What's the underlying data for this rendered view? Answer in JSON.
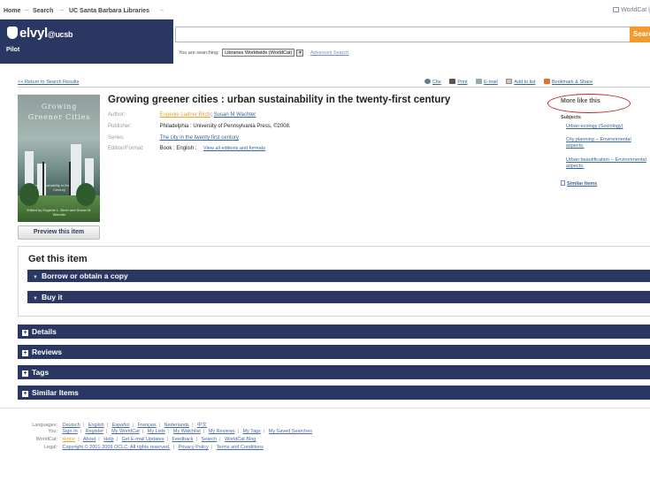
{
  "topnav": {
    "items": [
      "Home",
      "Search",
      "UC Santa Barbara Libraries"
    ],
    "worldcat_label": "WorldCat |"
  },
  "header": {
    "logo_text": "elvyl",
    "logo_suffix": "@ucsb",
    "pilot_label": "Pilot",
    "search_value": "",
    "search_button": "Search",
    "searching_label": "You are searching:",
    "scope_value": "Libraries Worldwide (WorldCat)",
    "advanced_search": "Advanced Search"
  },
  "result": {
    "back_link": "<< Return to Search Results",
    "actions": [
      "Cite",
      "Print",
      "E-mail",
      "Add to list",
      "Bookmark & Share"
    ],
    "title": "Growing greener cities : urban sustainability in the twenty-first century",
    "cover_title": "Growing Greener Cities",
    "cover_subtitle": "Urban Sustainability in the Twenty-First Century",
    "cover_authors": "Edited by Eugenie L. Birch and Susan M. Wachter",
    "preview_button": "Preview this item",
    "fields": {
      "author_label": "Author:",
      "author_1": "Eugenie Ladner Birch",
      "author_sep": ";",
      "author_2": "Susan M Wachter",
      "publisher_label": "Publisher:",
      "publisher": "Philadelphia : University of Pennsylvania Press, ©2008.",
      "series_label": "Series:",
      "series": "The city in the twenty-first century",
      "edition_label": "Edition/Format:",
      "edition": "Book : English :",
      "editions_link": "View all editions and formats"
    }
  },
  "more_like_this": {
    "title": "More like this",
    "subjects_label": "Subjects",
    "subjects": [
      "Urban ecology (Sociology)",
      "City planning -- Environmental aspects.",
      "Urban beautification -- Environmental aspects."
    ],
    "similar_items": "Similar Items"
  },
  "get_this": {
    "title": "Get this item",
    "bars": [
      "Borrow or obtain a copy",
      "Buy it"
    ]
  },
  "sections": [
    "Details",
    "Reviews",
    "Tags",
    "Similar Items"
  ],
  "footer": {
    "languages_label": "Languages:",
    "languages": [
      "Deutsch",
      "English",
      "Español",
      "Français",
      "Nederlands",
      "中文"
    ],
    "you_label": "You:",
    "you_links": [
      "Sign In",
      "Register",
      "My WorldCat",
      "My Lists",
      "My Watchlist",
      "My Reviews",
      "My Tags",
      "My Saved Searches"
    ],
    "worldcat_label": "WorldCat:",
    "worldcat_links": [
      "Home",
      "About",
      "Help",
      "Get E-mail Updates",
      "Feedback",
      "Search",
      "WorldCat Blog"
    ],
    "legal_label": "Legal:",
    "legal_links": [
      "Copyright © 2001-2009 OCLC. All rights reserved.",
      "Privacy Policy",
      "Terms and Conditions"
    ]
  },
  "colors": {
    "navy": "#2a3763",
    "orange": "#f39a2d",
    "link": "#336699",
    "highlight_oval": "#c0202e"
  }
}
